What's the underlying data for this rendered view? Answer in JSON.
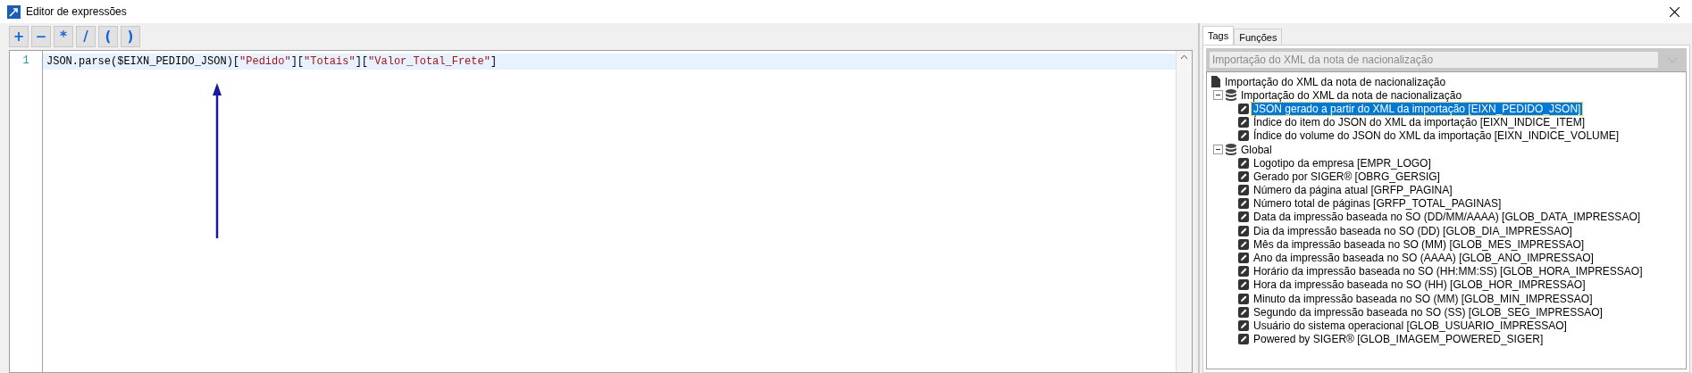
{
  "window": {
    "title": "Editor de expressões"
  },
  "toolbar": {
    "buttons": [
      "+",
      "−",
      "*",
      "/",
      "(",
      ")"
    ]
  },
  "editor": {
    "line_number": "1",
    "tokens": [
      {
        "text": "JSON.parse($EIXN_PEDIDO_JSON)[",
        "kind": "plain"
      },
      {
        "text": "\"Pedido\"",
        "kind": "string"
      },
      {
        "text": "][",
        "kind": "plain"
      },
      {
        "text": "\"Totais\"",
        "kind": "string"
      },
      {
        "text": "][",
        "kind": "plain"
      },
      {
        "text": "\"Valor_Total_Frete\"",
        "kind": "string"
      },
      {
        "text": "]",
        "kind": "plain"
      }
    ]
  },
  "tabs": [
    {
      "label": "Tags",
      "selected": true
    },
    {
      "label": "Funções",
      "selected": false
    }
  ],
  "source_select": {
    "value": "Importação do XML da nota de nacionalização",
    "disabled": true
  },
  "tree": [
    {
      "label": "Importação do XML da nota de nacionalização",
      "kind": "document",
      "children": [
        {
          "label": "Importação do XML da nota de nacionalização",
          "kind": "group",
          "expanded": true,
          "children": [
            {
              "label": "JSON gerado a partir do XML da importação [EIXN_PEDIDO_JSON]",
              "kind": "tag",
              "selected": true
            },
            {
              "label": "Índice do item do JSON do XML da importação [EIXN_INDICE_ITEM]",
              "kind": "tag",
              "selected": false
            },
            {
              "label": "Índice do volume do JSON do XML da importação [EIXN_INDICE_VOLUME]",
              "kind": "tag",
              "selected": false
            }
          ]
        },
        {
          "label": "Global",
          "kind": "group",
          "expanded": true,
          "children": [
            {
              "label": "Logotipo da empresa [EMPR_LOGO]",
              "kind": "tag",
              "selected": false
            },
            {
              "label": "Gerado por SIGER® [OBRG_GERSIG]",
              "kind": "tag",
              "selected": false
            },
            {
              "label": "Número da página atual [GRFP_PAGINA]",
              "kind": "tag",
              "selected": false
            },
            {
              "label": "Número total de páginas [GRFP_TOTAL_PAGINAS]",
              "kind": "tag",
              "selected": false
            },
            {
              "label": "Data da impressão baseada no SO (DD/MM/AAAA) [GLOB_DATA_IMPRESSAO]",
              "kind": "tag",
              "selected": false
            },
            {
              "label": "Dia da impressão baseada no SO (DD) [GLOB_DIA_IMPRESSAO]",
              "kind": "tag",
              "selected": false
            },
            {
              "label": "Mês da impressão baseada no SO (MM) [GLOB_MES_IMPRESSAO]",
              "kind": "tag",
              "selected": false
            },
            {
              "label": "Ano da impressão baseada no SO (AAAA) [GLOB_ANO_IMPRESSAO]",
              "kind": "tag",
              "selected": false
            },
            {
              "label": "Horário da impressão baseada no SO (HH:MM:SS) [GLOB_HORA_IMPRESSAO]",
              "kind": "tag",
              "selected": false
            },
            {
              "label": "Hora da impressão baseada no SO (HH) [GLOB_HOR_IMPRESSAO]",
              "kind": "tag",
              "selected": false
            },
            {
              "label": "Minuto da impressão baseada no SO (MM) [GLOB_MIN_IMPRESSAO]",
              "kind": "tag",
              "selected": false
            },
            {
              "label": "Segundo da impressão baseada no SO (SS) [GLOB_SEG_IMPRESSAO]",
              "kind": "tag",
              "selected": false
            },
            {
              "label": "Usuário do sistema operacional [GLOB_USUARIO_IMPRESSAO]",
              "kind": "tag",
              "selected": false
            },
            {
              "label": "Powered by SIGER® [GLOB_IMAGEM_POWERED_SIGER]",
              "kind": "tag",
              "selected": false
            }
          ]
        }
      ]
    }
  ]
}
